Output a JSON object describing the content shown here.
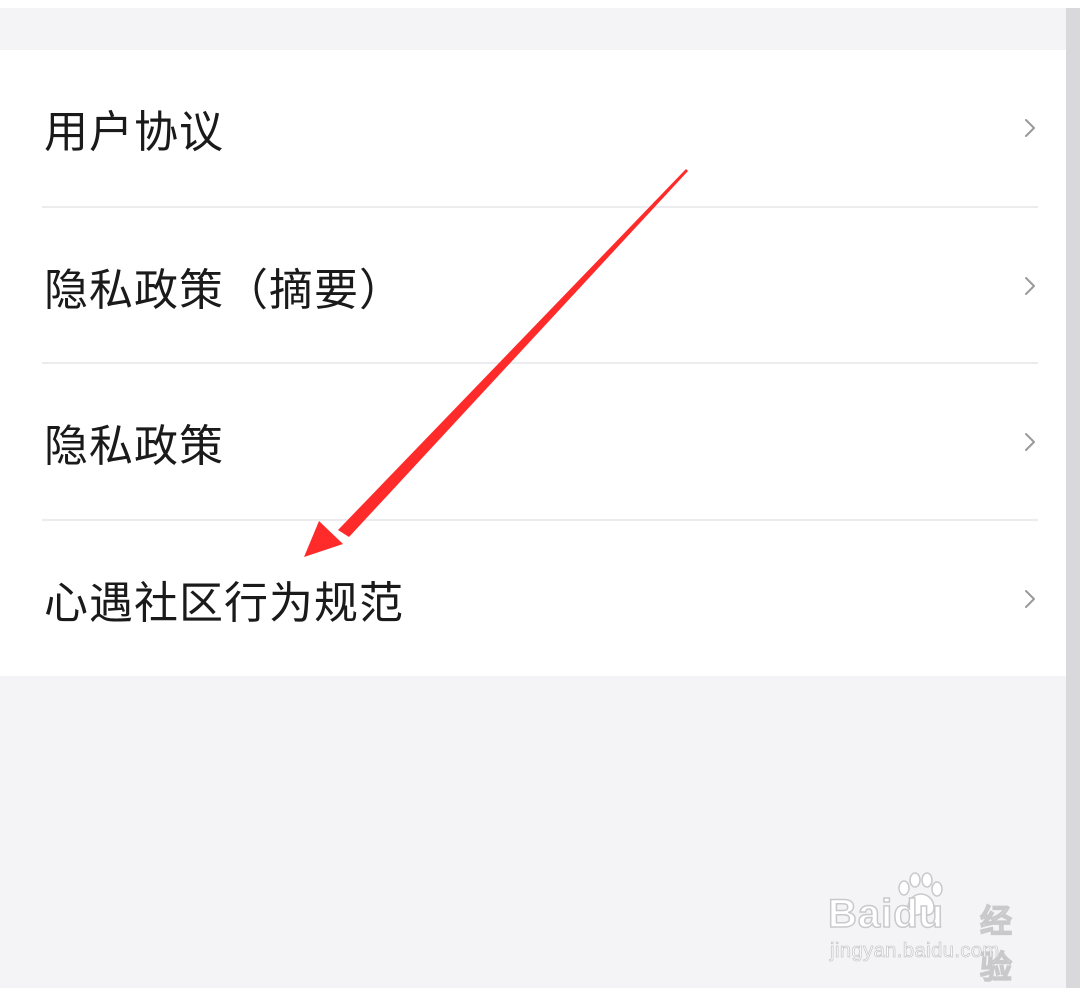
{
  "menu": {
    "items": [
      {
        "label": "用户协议"
      },
      {
        "label": "隐私政策（摘要）"
      },
      {
        "label": "隐私政策"
      },
      {
        "label": "心遇社区行为规范"
      }
    ]
  },
  "annotation": {
    "arrow_color": "#ff2a2a"
  },
  "watermark": {
    "brand": "Baidu",
    "product": "经验",
    "url": "jingyan.baidu.com"
  },
  "icons": {
    "row_chevron": "chevron-right-icon"
  },
  "colors": {
    "background": "#f4f4f6",
    "surface": "#ffffff",
    "text": "#1a1a1a",
    "chevron": "#9a9a9e",
    "divider": "#ececee"
  }
}
